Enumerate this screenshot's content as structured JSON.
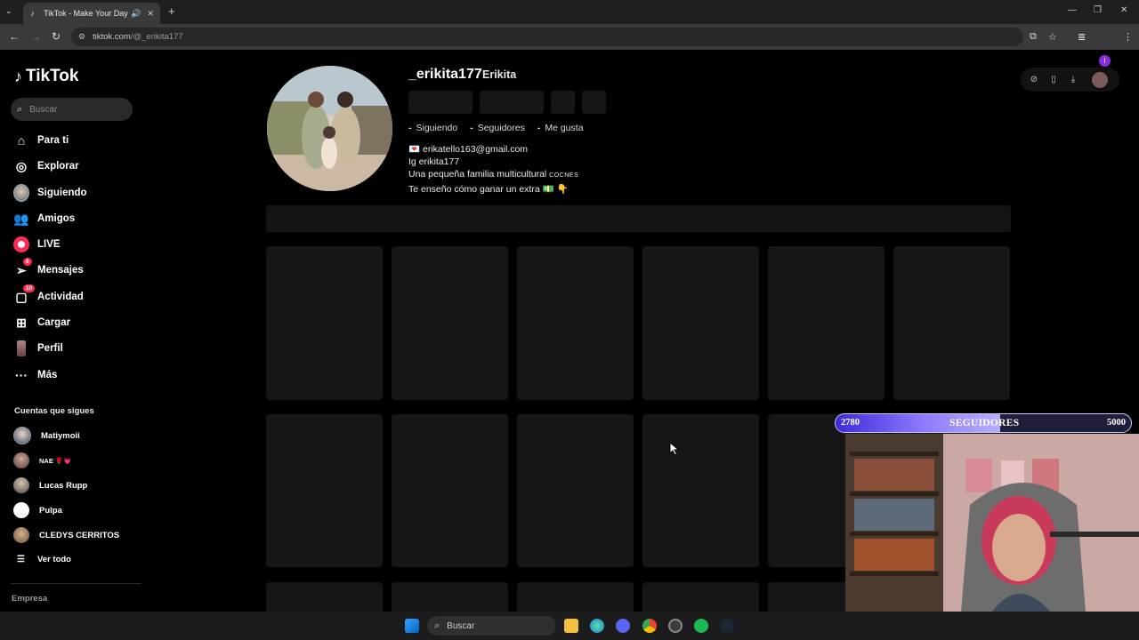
{
  "browser": {
    "tab_title": "TikTok - Make Your Day",
    "url_domain": "tiktok.com",
    "url_path": "/@_erikita177"
  },
  "sidebar": {
    "logo": "TikTok",
    "search_placeholder": "Buscar",
    "items": [
      {
        "label": "Para ti",
        "icon": "home-icon"
      },
      {
        "label": "Explorar",
        "icon": "compass-icon"
      },
      {
        "label": "Siguiendo",
        "icon": "following-avatar-icon"
      },
      {
        "label": "Amigos",
        "icon": "friends-icon"
      },
      {
        "label": "LIVE",
        "icon": "live-icon"
      },
      {
        "label": "Mensajes",
        "icon": "send-icon",
        "badge": "6"
      },
      {
        "label": "Actividad",
        "icon": "inbox-icon",
        "badge": "10"
      },
      {
        "label": "Cargar",
        "icon": "upload-icon"
      },
      {
        "label": "Perfil",
        "icon": "profile-avatar-icon"
      },
      {
        "label": "Más",
        "icon": "more-icon"
      }
    ],
    "following_title": "Cuentas que sigues",
    "following": [
      {
        "name": "Matiymoii"
      },
      {
        "name": "NAE 🌹💗"
      },
      {
        "name": "Lucas Rupp"
      },
      {
        "name": "Pulpa"
      },
      {
        "name": "CLEDYS CERRITOS"
      }
    ],
    "see_all": "Ver todo",
    "company": "Empresa"
  },
  "profile": {
    "username": "_erikita177",
    "display_name": "Erikita",
    "stats": [
      {
        "value": "-",
        "label": "Siguiendo"
      },
      {
        "value": "-",
        "label": "Seguidores"
      },
      {
        "value": "-",
        "label": "Me gusta"
      }
    ],
    "bio": {
      "email": "💌 erikatello163@gmail.com",
      "ig": "Ig erikita177",
      "line3": "Una pequeña familia multicultural",
      "line3_small": "COCNES",
      "line4": "Te enseño cómo ganar un extra 💵 👇"
    }
  },
  "overlay": {
    "current": "2780",
    "label": "SEGUIDORES",
    "target": "5000",
    "progress": 0.556
  },
  "taskbar": {
    "search_placeholder": "Buscar"
  }
}
